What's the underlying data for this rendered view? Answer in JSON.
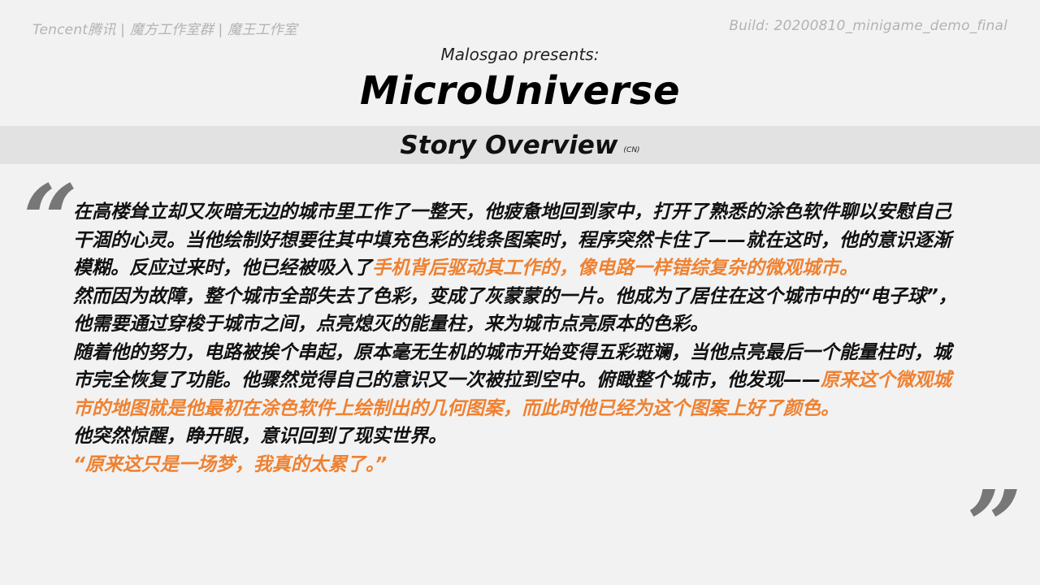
{
  "header": {
    "credits": "Tencent腾讯 | 魔方工作室群 | 魔王工作室",
    "build": "Build: 20200810_minigame_demo_final"
  },
  "presents": "Malosgao presents:",
  "title": "MicroUniverse",
  "section": {
    "title": "Story Overview",
    "lang": "(CN)"
  },
  "quotes": {
    "open": "“",
    "close": "”"
  },
  "story": {
    "p1_a": "在高楼耸立却又灰暗无边的城市里工作了一整天，他疲惫地回到家中，打开了熟悉的涂色软件聊以安慰自己干涸的心灵。当他绘制好想要往其中填充色彩的线条图案时，程序突然卡住了——就在这时，他的意识逐渐模糊。反应过来时，他已经被吸入了",
    "p1_b": "手机背后驱动其工作的，像电路一样错综复杂的微观城市。",
    "p2": "然而因为故障，整个城市全部失去了色彩，变成了灰蒙蒙的一片。他成为了居住在这个城市中的“电子球”，他需要通过穿梭于城市之间，点亮熄灭的能量柱，来为城市点亮原本的色彩。",
    "p3_a": "随着他的努力，电路被挨个串起，原本毫无生机的城市开始变得五彩斑斓，当他点亮最后一个能量柱时，城市完全恢复了功能。他骤然觉得自己的意识又一次被拉到空中。俯瞰整个城市，他发现——",
    "p3_b": "原来这个微观城市的地图就是他最初在涂色软件上绘制出的几何图案，而此时他已经为这个图案上好了颜色。",
    "p4": "他突然惊醒，睁开眼，意识回到了现实世界。",
    "p5": "“原来这只是一场梦，我真的太累了。”"
  },
  "colors": {
    "background": "#f2f2f2",
    "band": "#e2e2e2",
    "highlight": "#ef8131",
    "quote_marks": "#777777"
  }
}
